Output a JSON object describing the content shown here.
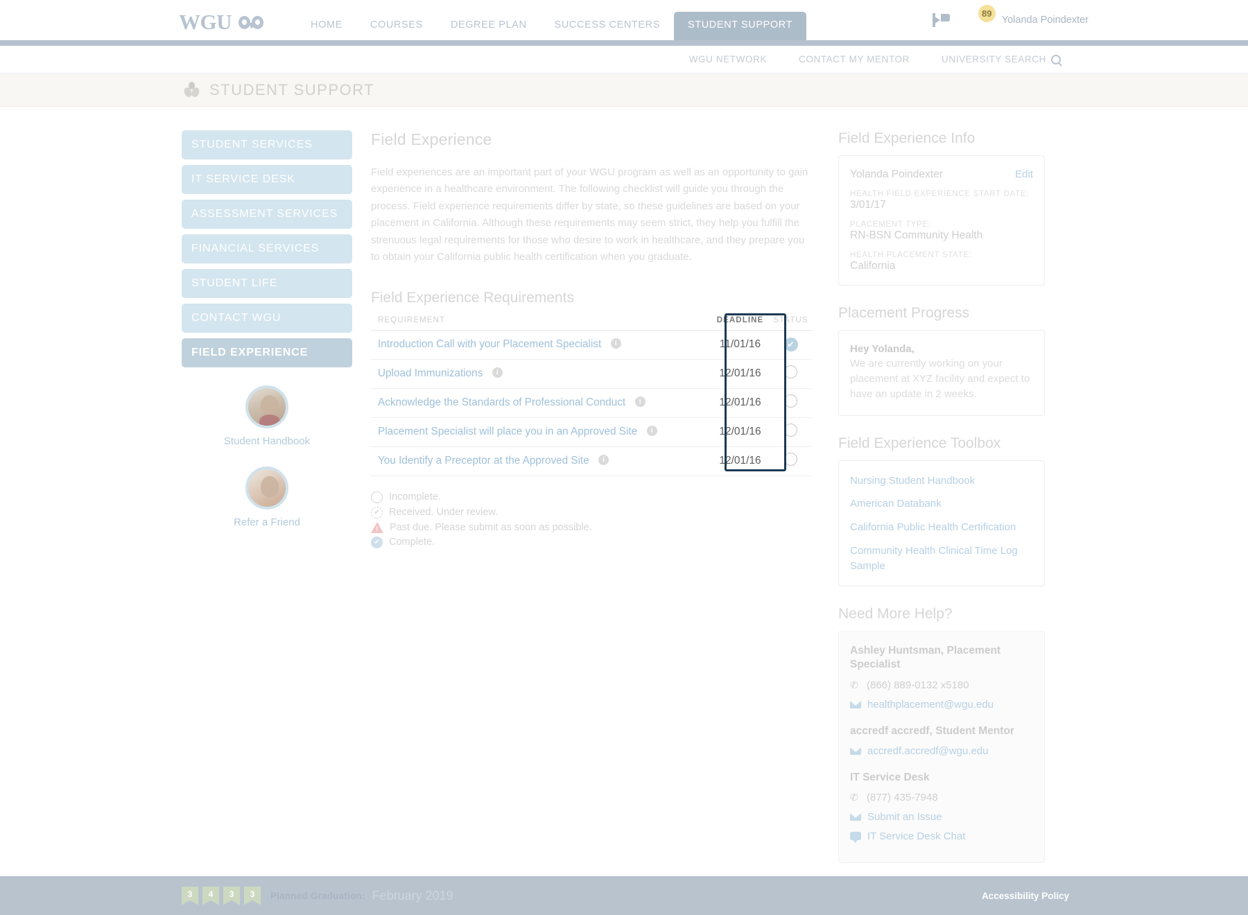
{
  "header": {
    "brand": "WGU",
    "brand_icon": "owl-icon",
    "nav": [
      {
        "label": "HOME",
        "active": false
      },
      {
        "label": "COURSES",
        "active": false
      },
      {
        "label": "DEGREE PLAN",
        "active": false
      },
      {
        "label": "SUCCESS CENTERS",
        "active": false
      },
      {
        "label": "STUDENT SUPPORT",
        "active": true
      }
    ],
    "megaphone_icon": "megaphone-icon",
    "mail_icon": "mail-icon",
    "mail_badge": "89",
    "user_name": "Yolanda Poindexter"
  },
  "subnav": {
    "items": [
      "WGU NETWORK",
      "CONTACT MY MENTOR"
    ],
    "search_label": "UNIVERSITY SEARCH",
    "search_icon": "magnifier-icon"
  },
  "page_header": {
    "icon": "helping-hands-icon",
    "title": "STUDENT SUPPORT"
  },
  "sidebar": {
    "items": [
      {
        "label": "STUDENT SERVICES",
        "active": false
      },
      {
        "label": "IT SERVICE DESK",
        "active": false
      },
      {
        "label": "ASSESSMENT SERVICES",
        "active": false
      },
      {
        "label": "FINANCIAL SERVICES",
        "active": false
      },
      {
        "label": "STUDENT LIFE",
        "active": false
      },
      {
        "label": "CONTACT WGU",
        "active": false
      },
      {
        "label": "FIELD EXPERIENCE",
        "active": true
      }
    ],
    "promos": [
      {
        "label": "Student Handbook",
        "icon": "student-photo-avatar"
      },
      {
        "label": "Refer a Friend",
        "icon": "friends-photo-avatar"
      }
    ]
  },
  "main": {
    "title": "Field Experience",
    "intro": "Field experiences are an important part of your WGU program as well as an opportunity to gain experience in a healthcare environment. The following checklist will guide you through the process. Field experience requirements differ by state, so these guidelines are based on your placement in California. Although these requirements may seem strict, they help you fulfill the strenuous legal requirements for those who desire to work in healthcare, and they prepare you to obtain your California public health certification when you graduate.",
    "requirements_title": "Field Experience Requirements",
    "table": {
      "columns": [
        "REQUIREMENT",
        "DEADLINE",
        "STATUS"
      ],
      "rows": [
        {
          "requirement": "Introduction Call with your Placement Specialist",
          "info_icon": "info-icon",
          "deadline": "11/01/16",
          "status": "complete"
        },
        {
          "requirement": "Upload Immunizations",
          "info_icon": "info-icon",
          "deadline": "12/01/16",
          "status": "incomplete"
        },
        {
          "requirement": "Acknowledge the Standards of Professional Conduct",
          "info_icon": "info-icon",
          "deadline": "12/01/16",
          "status": "incomplete"
        },
        {
          "requirement": "Placement Specialist will place you in an Approved Site",
          "info_icon": "info-icon",
          "deadline": "12/01/16",
          "status": "incomplete"
        },
        {
          "requirement": "You Identify a Preceptor at the Approved Site",
          "info_icon": "info-icon",
          "deadline": "12/01/16",
          "status": "incomplete"
        }
      ],
      "highlight_color": "#1b3a54"
    },
    "legend": [
      {
        "icon": "empty-circle-icon",
        "text": "Incomplete."
      },
      {
        "icon": "dashed-check-circle-icon",
        "text": "Received. Under review."
      },
      {
        "icon": "warning-triangle-icon",
        "text": "Past due. Please submit as soon as possible."
      },
      {
        "icon": "check-circle-icon",
        "text": "Complete."
      }
    ]
  },
  "right": {
    "info": {
      "title": "Field Experience Info",
      "name": "Yolanda Poindexter",
      "edit_label": "Edit",
      "fields": [
        {
          "label": "HEALTH FIELD EXPERIENCE START DATE:",
          "value": "3/01/17"
        },
        {
          "label": "PLACEMENT TYPE:",
          "value": "RN-BSN Community Health"
        },
        {
          "label": "HEALTH PLACEMENT STATE:",
          "value": "California"
        }
      ]
    },
    "progress": {
      "title": "Placement Progress",
      "greeting": "Hey Yolanda,",
      "body": "We are currently working on your placement at XYZ facility and expect to have an update in 2 weeks."
    },
    "toolbox": {
      "title": "Field Experience Toolbox",
      "links": [
        "Nursing Student Handbook",
        "American Databank",
        "California Public Health Certification",
        "Community Health Clinical Time Log Sample"
      ]
    },
    "help": {
      "title": "Need More Help?",
      "contacts": [
        {
          "name": "Ashley Huntsman, Placement Specialist",
          "rows": [
            {
              "icon": "phone-icon",
              "text": "(866) 889-0132 x5180",
              "link": false
            },
            {
              "icon": "envelope-icon",
              "text": "healthplacement@wgu.edu",
              "link": true
            }
          ]
        },
        {
          "name": "accredf accredf, Student Mentor",
          "rows": [
            {
              "icon": "envelope-icon",
              "text": "accredf.accredf@wgu.edu",
              "link": true
            }
          ]
        },
        {
          "name": "IT Service Desk",
          "rows": [
            {
              "icon": "phone-icon",
              "text": "(877) 435-7948",
              "link": false
            },
            {
              "icon": "envelope-icon",
              "text": "Submit an Issue",
              "link": true
            },
            {
              "icon": "chat-icon",
              "text": "IT Service Desk Chat",
              "link": true
            }
          ]
        }
      ]
    }
  },
  "footer": {
    "ribbons": [
      "3",
      "4",
      "3",
      "3"
    ],
    "graduation_label": "Planned Graduation:",
    "graduation_value": "February 2019",
    "accessibility_label": "Accessibility Policy"
  }
}
